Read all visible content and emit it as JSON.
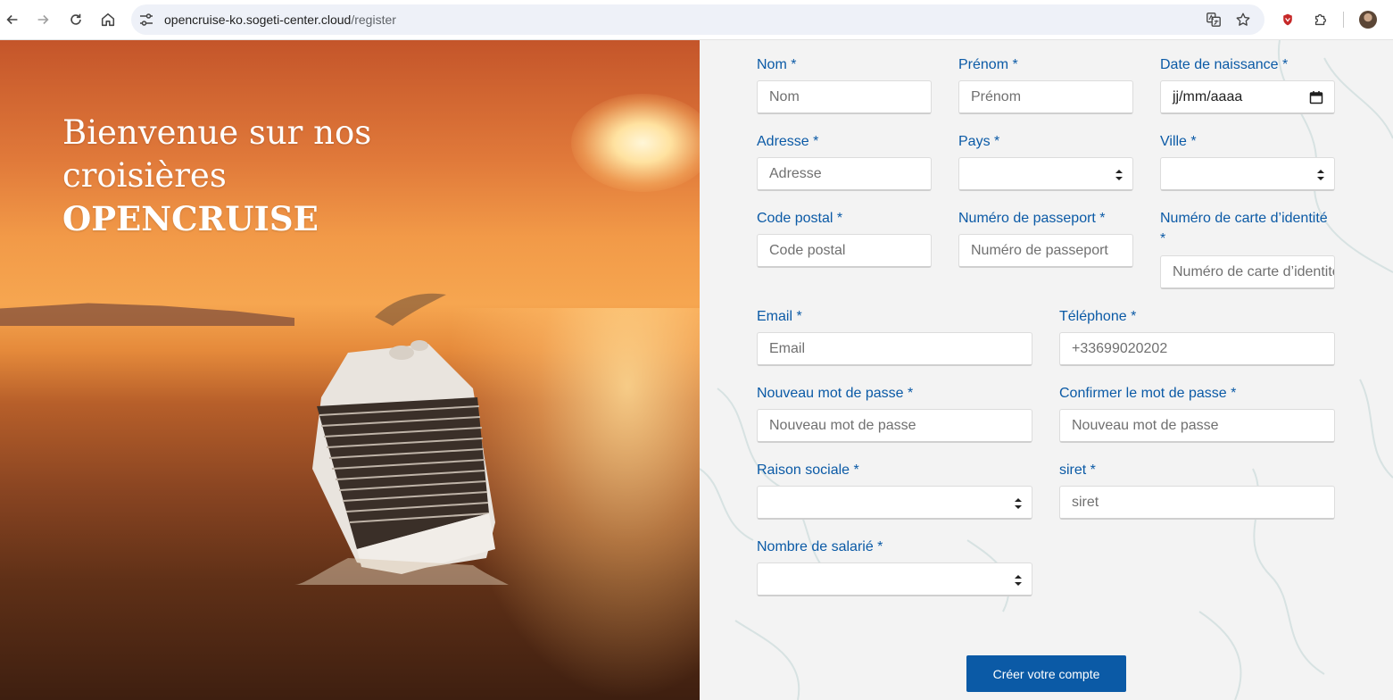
{
  "browser": {
    "url_host": "opencruise-ko.sogeti-center.cloud",
    "url_path": "/register"
  },
  "hero": {
    "line1": "Bienvenue sur nos",
    "line2": "croisières",
    "line3": "OPENCRUISE"
  },
  "form": {
    "nom": {
      "label": "Nom *",
      "placeholder": "Nom"
    },
    "prenom": {
      "label": "Prénom *",
      "placeholder": "Prénom"
    },
    "naissance": {
      "label": "Date de naissance *",
      "value": "jj/mm/aaaa"
    },
    "adresse": {
      "label": "Adresse *",
      "placeholder": "Adresse"
    },
    "pays": {
      "label": "Pays *",
      "value": ""
    },
    "ville": {
      "label": "Ville *",
      "value": ""
    },
    "code_postal": {
      "label": "Code postal *",
      "placeholder": "Code postal"
    },
    "passeport": {
      "label": "Numéro de passeport *",
      "placeholder": "Numéro de passeport"
    },
    "carte_identite": {
      "label": "Numéro de carte d’identité *",
      "placeholder": "Numéro de carte d’identité"
    },
    "email": {
      "label": "Email *",
      "placeholder": "Email"
    },
    "telephone": {
      "label": "Téléphone *",
      "placeholder": "+33699020202"
    },
    "mot_de_passe": {
      "label": "Nouveau mot de passe *",
      "placeholder": "Nouveau mot de passe"
    },
    "confirmer": {
      "label": "Confirmer le mot de passe *",
      "placeholder": "Nouveau mot de passe"
    },
    "raison_sociale": {
      "label": "Raison sociale *",
      "value": ""
    },
    "siret": {
      "label": "siret *",
      "placeholder": "siret"
    },
    "salaries": {
      "label": "Nombre de salarié *",
      "value": ""
    },
    "submit_label": "Créer votre compte"
  },
  "colors": {
    "label": "#0b5aa6",
    "button": "#0b5aa6",
    "form_bg": "#f3f3f3"
  }
}
